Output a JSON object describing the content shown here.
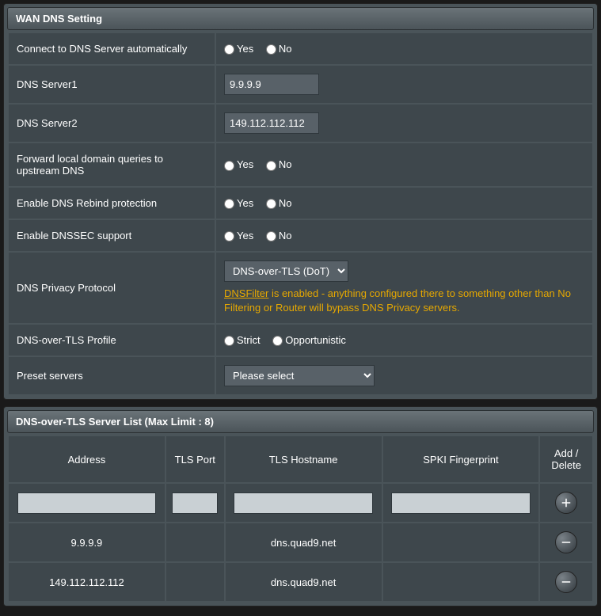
{
  "wan_dns": {
    "header": "WAN DNS Setting",
    "rows": {
      "connect_auto": {
        "label": "Connect to DNS Server automatically",
        "yes": "Yes",
        "no": "No"
      },
      "dns1": {
        "label": "DNS Server1",
        "value": "9.9.9.9"
      },
      "dns2": {
        "label": "DNS Server2",
        "value": "149.112.112.112"
      },
      "forward_local": {
        "label": "Forward local domain queries to upstream DNS",
        "yes": "Yes",
        "no": "No"
      },
      "rebind": {
        "label": "Enable DNS Rebind protection",
        "yes": "Yes",
        "no": "No"
      },
      "dnssec": {
        "label": "Enable DNSSEC support",
        "yes": "Yes",
        "no": "No"
      },
      "privacy": {
        "label": "DNS Privacy Protocol",
        "selected": "DNS-over-TLS (DoT)",
        "warn_link": "DNSFilter",
        "warn_rest": " is enabled - anything configured there to something other than No Filtering or Router will bypass DNS Privacy servers."
      },
      "dot_profile": {
        "label": "DNS-over-TLS Profile",
        "strict": "Strict",
        "opp": "Opportunistic"
      },
      "preset": {
        "label": "Preset servers",
        "selected": "Please select"
      }
    }
  },
  "dot_list": {
    "header": "DNS-over-TLS Server List (Max Limit : 8)",
    "cols": {
      "address": "Address",
      "tls_port": "TLS Port",
      "tls_hostname": "TLS Hostname",
      "spki": "SPKI Fingerprint",
      "add_delete": "Add / Delete"
    },
    "rows": [
      {
        "address": "9.9.9.9",
        "tls_port": "",
        "tls_hostname": "dns.quad9.net",
        "spki": ""
      },
      {
        "address": "149.112.112.112",
        "tls_port": "",
        "tls_hostname": "dns.quad9.net",
        "spki": ""
      }
    ]
  }
}
